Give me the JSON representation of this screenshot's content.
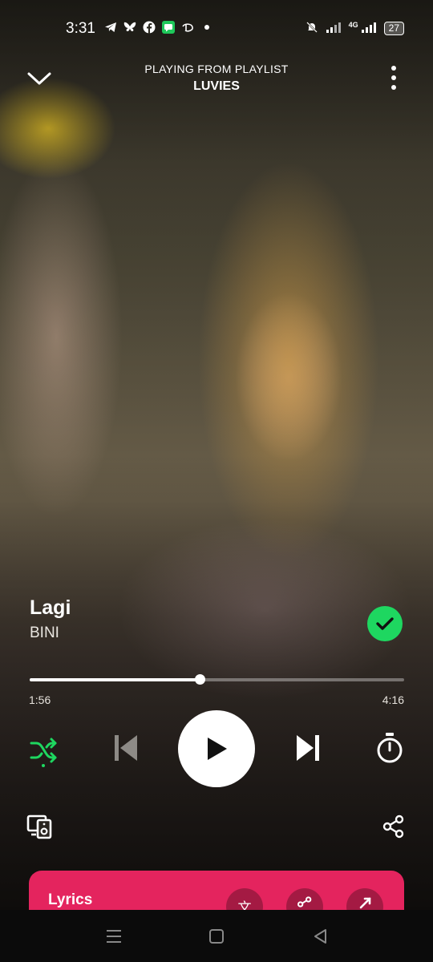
{
  "status_bar": {
    "time": "3:31",
    "left_icons": [
      "telegram-icon",
      "bluesky-icon",
      "facebook-icon",
      "messages-icon",
      "disney-icon",
      "dot-icon"
    ],
    "network": "4G",
    "battery": "27"
  },
  "header": {
    "context": "PLAYING FROM PLAYLIST",
    "playlist": "LUVIES"
  },
  "track": {
    "title": "Lagi",
    "artist": "BINI",
    "liked": true
  },
  "progress": {
    "elapsed": "1:56",
    "total": "4:16",
    "fraction": 0.453
  },
  "controls": {
    "shuffle_active": true,
    "state": "paused"
  },
  "lyrics": {
    "label": "Lyrics"
  },
  "colors": {
    "accent_green": "#1ed760",
    "lyrics_card": "#e4245e"
  }
}
